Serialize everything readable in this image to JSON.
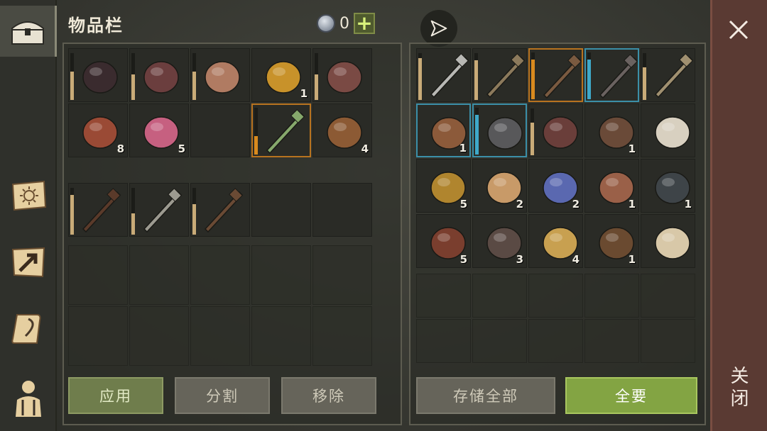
{
  "header": {
    "title": "物品栏",
    "currency_count": "0",
    "add_label": "+"
  },
  "sidebar": {
    "tabs": [
      {
        "name": "inventory-chest-icon"
      },
      {
        "name": "day-scroll-icon"
      },
      {
        "name": "map-arrow-icon"
      },
      {
        "name": "quest-scroll-icon"
      },
      {
        "name": "character-icon"
      }
    ]
  },
  "player_inventory": {
    "rows": [
      [
        {
          "icon": "pants-icon",
          "qty": "",
          "durability": 0.6,
          "color": "#3a2b2e"
        },
        {
          "icon": "chainmail-gloves-icon",
          "qty": "",
          "durability": 0.55,
          "color": "#6b3e3e"
        },
        {
          "icon": "kettle-hat-icon",
          "qty": "",
          "durability": 0.6,
          "color": "#b07b62"
        },
        {
          "icon": "flame-drop-icon",
          "qty": "1",
          "durability": null,
          "color": "#c8922a"
        },
        {
          "icon": "chainmail-shirt-icon",
          "qty": "",
          "durability": 0.55,
          "color": "#7a4a44"
        }
      ],
      [
        {
          "icon": "bacon-icon",
          "qty": "8",
          "durability": null,
          "color": "#9a4a35"
        },
        {
          "icon": "berry-bowl-icon",
          "qty": "5",
          "durability": null,
          "color": "#c66080"
        },
        {
          "icon": "",
          "qty": "",
          "durability": null,
          "color": ""
        },
        {
          "icon": "poison-dagger-icon",
          "qty": "",
          "durability": 0.4,
          "color": "#86a86c",
          "selected": "orange"
        },
        {
          "icon": "barrel-icon",
          "qty": "4",
          "durability": null,
          "color": "#8c5a34"
        }
      ]
    ],
    "hotbar": [
      {
        "icon": "mace-icon",
        "qty": "",
        "durability": 0.85,
        "color": "#5a3a2a"
      },
      {
        "icon": "sword-icon",
        "qty": "",
        "durability": 0.45,
        "color": "#9c9a90"
      },
      {
        "icon": "crossbow-icon",
        "qty": "",
        "durability": 0.65,
        "color": "#6a4a34"
      },
      {
        "icon": "",
        "qty": "",
        "durability": null,
        "color": ""
      },
      {
        "icon": "",
        "qty": "",
        "durability": null,
        "color": ""
      }
    ]
  },
  "storage": {
    "rows": [
      [
        {
          "icon": "longsword-icon",
          "qty": "",
          "durability": 0.9,
          "color": "#b8b8b4"
        },
        {
          "icon": "halberd-icon",
          "qty": "",
          "durability": 0.85,
          "color": "#8c7a5c"
        },
        {
          "icon": "pickaxe-icon",
          "qty": "",
          "durability": 0.85,
          "color": "#7a5a40",
          "selected": "orange"
        },
        {
          "icon": "warhammer-icon",
          "qty": "",
          "durability": 0.85,
          "color": "#6a6260",
          "selected": "blue"
        },
        {
          "icon": "greatsword-icon",
          "qty": "",
          "durability": 0.7,
          "color": "#a09070"
        }
      ],
      [
        {
          "icon": "frame-trap-icon",
          "qty": "1",
          "durability": null,
          "color": "#8c5a3a",
          "selected": "blue"
        },
        {
          "icon": "great-helm-icon",
          "qty": "",
          "durability": 0.85,
          "color": "#58585a",
          "selected": "blue"
        },
        {
          "icon": "gauntlets-icon",
          "qty": "",
          "durability": 0.7,
          "color": "#6a3e3a"
        },
        {
          "icon": "bear-trap-icon",
          "qty": "1",
          "durability": null,
          "color": "#6a4a38"
        },
        {
          "icon": "blueprint-icon",
          "qty": "",
          "durability": null,
          "color": "#d8d0c0"
        }
      ],
      [
        {
          "icon": "gold-ingot-icon",
          "qty": "5",
          "durability": null,
          "color": "#b0852e"
        },
        {
          "icon": "seeds-icon",
          "qty": "2",
          "durability": null,
          "color": "#c89a68"
        },
        {
          "icon": "crystal-icon",
          "qty": "2",
          "durability": null,
          "color": "#5a68b0"
        },
        {
          "icon": "padlock-icon",
          "qty": "1",
          "durability": null,
          "color": "#9a6048"
        },
        {
          "icon": "gear-icon",
          "qty": "1",
          "durability": null,
          "color": "#3e4448"
        }
      ],
      [
        {
          "icon": "leather-icon",
          "qty": "5",
          "durability": null,
          "color": "#7a3e2e"
        },
        {
          "icon": "chain-icon",
          "qty": "3",
          "durability": null,
          "color": "#5a4a44"
        },
        {
          "icon": "candle-icon",
          "qty": "4",
          "durability": null,
          "color": "#c8a050"
        },
        {
          "icon": "rope-icon",
          "qty": "1",
          "durability": null,
          "color": "#6a4a30"
        },
        {
          "icon": "scroll-icon",
          "qty": "",
          "durability": null,
          "color": "#d8c8a8"
        }
      ]
    ]
  },
  "buttons": {
    "use": "应用",
    "split": "分割",
    "remove": "移除",
    "store_all": "存储全部",
    "take_all": "全要"
  },
  "close": {
    "label": "关闭"
  },
  "colors": {
    "durability_default": "#c9ab78",
    "durability_orange": "#d98a1e",
    "durability_blue": "#3fa9c9"
  }
}
